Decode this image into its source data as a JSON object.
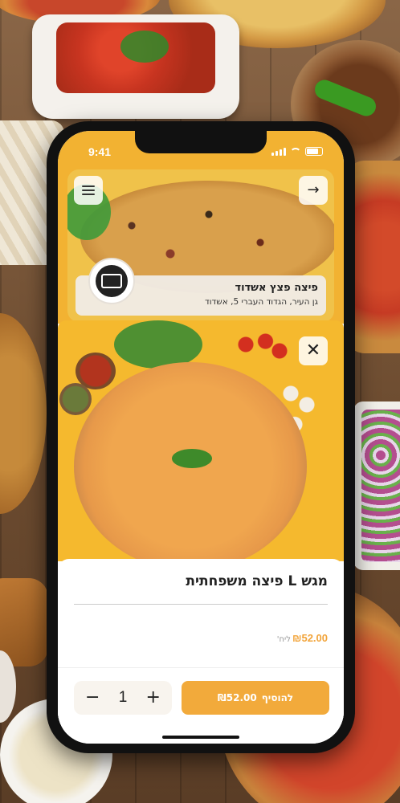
{
  "status_bar": {
    "time": "9:41"
  },
  "restaurant": {
    "name": "פיצה פצץ אשדוד",
    "address": "גן העיר, הגדוד העברי 5, אשדוד"
  },
  "product": {
    "title": "מגש L פיצה משפחתית",
    "price": "₪52.00",
    "price_unit": "ליח'"
  },
  "cart": {
    "quantity": "1",
    "minus": "−",
    "plus": "+",
    "add_label": "להוסיף",
    "add_total": "₪52.00"
  },
  "icons": {
    "close": "✕",
    "arrow": "→"
  },
  "colors": {
    "accent": "#f2aa3b",
    "header_bg": "#f2b232"
  }
}
